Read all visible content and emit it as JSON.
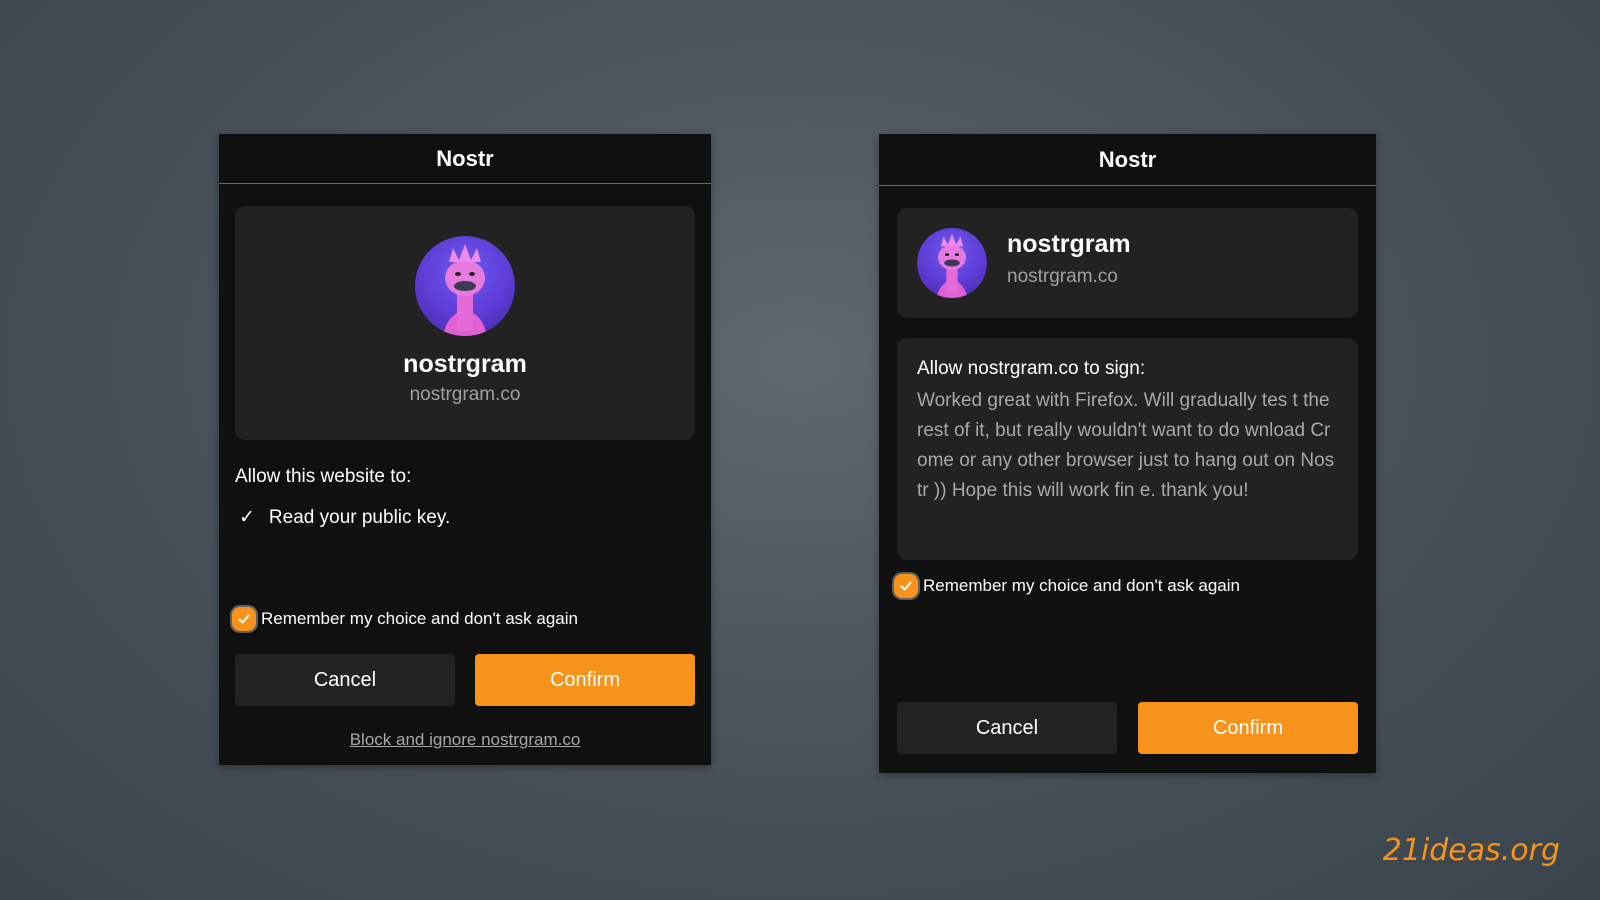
{
  "left_popup": {
    "title": "Nostr",
    "site": {
      "name": "nostrgram",
      "domain": "nostrgram.co"
    },
    "permissions_heading": "Allow this website to:",
    "permissions": [
      {
        "check": "✓",
        "label": "Read your public key."
      }
    ],
    "remember_label": "Remember my choice and don't ask again",
    "remember_checked": true,
    "cancel_label": "Cancel",
    "confirm_label": "Confirm",
    "block_label": "Block and ignore nostrgram.co"
  },
  "right_popup": {
    "title": "Nostr",
    "site": {
      "name": "nostrgram",
      "domain": "nostrgram.co"
    },
    "sign_heading": "Allow nostrgram.co to sign:",
    "sign_content": "Worked great with Firefox. Will gradually tes t the rest of it, but really wouldn't want to do wnload Crome or any other browser just to hang out on Nostr )) Hope this will work fin e. thank you!",
    "remember_label": "Remember my choice and don't ask again",
    "remember_checked": true,
    "cancel_label": "Cancel",
    "confirm_label": "Confirm"
  },
  "watermark": "21ideas.org",
  "colors": {
    "accent": "#f7931a",
    "popup_bg": "#101010",
    "card_bg": "#222222"
  }
}
